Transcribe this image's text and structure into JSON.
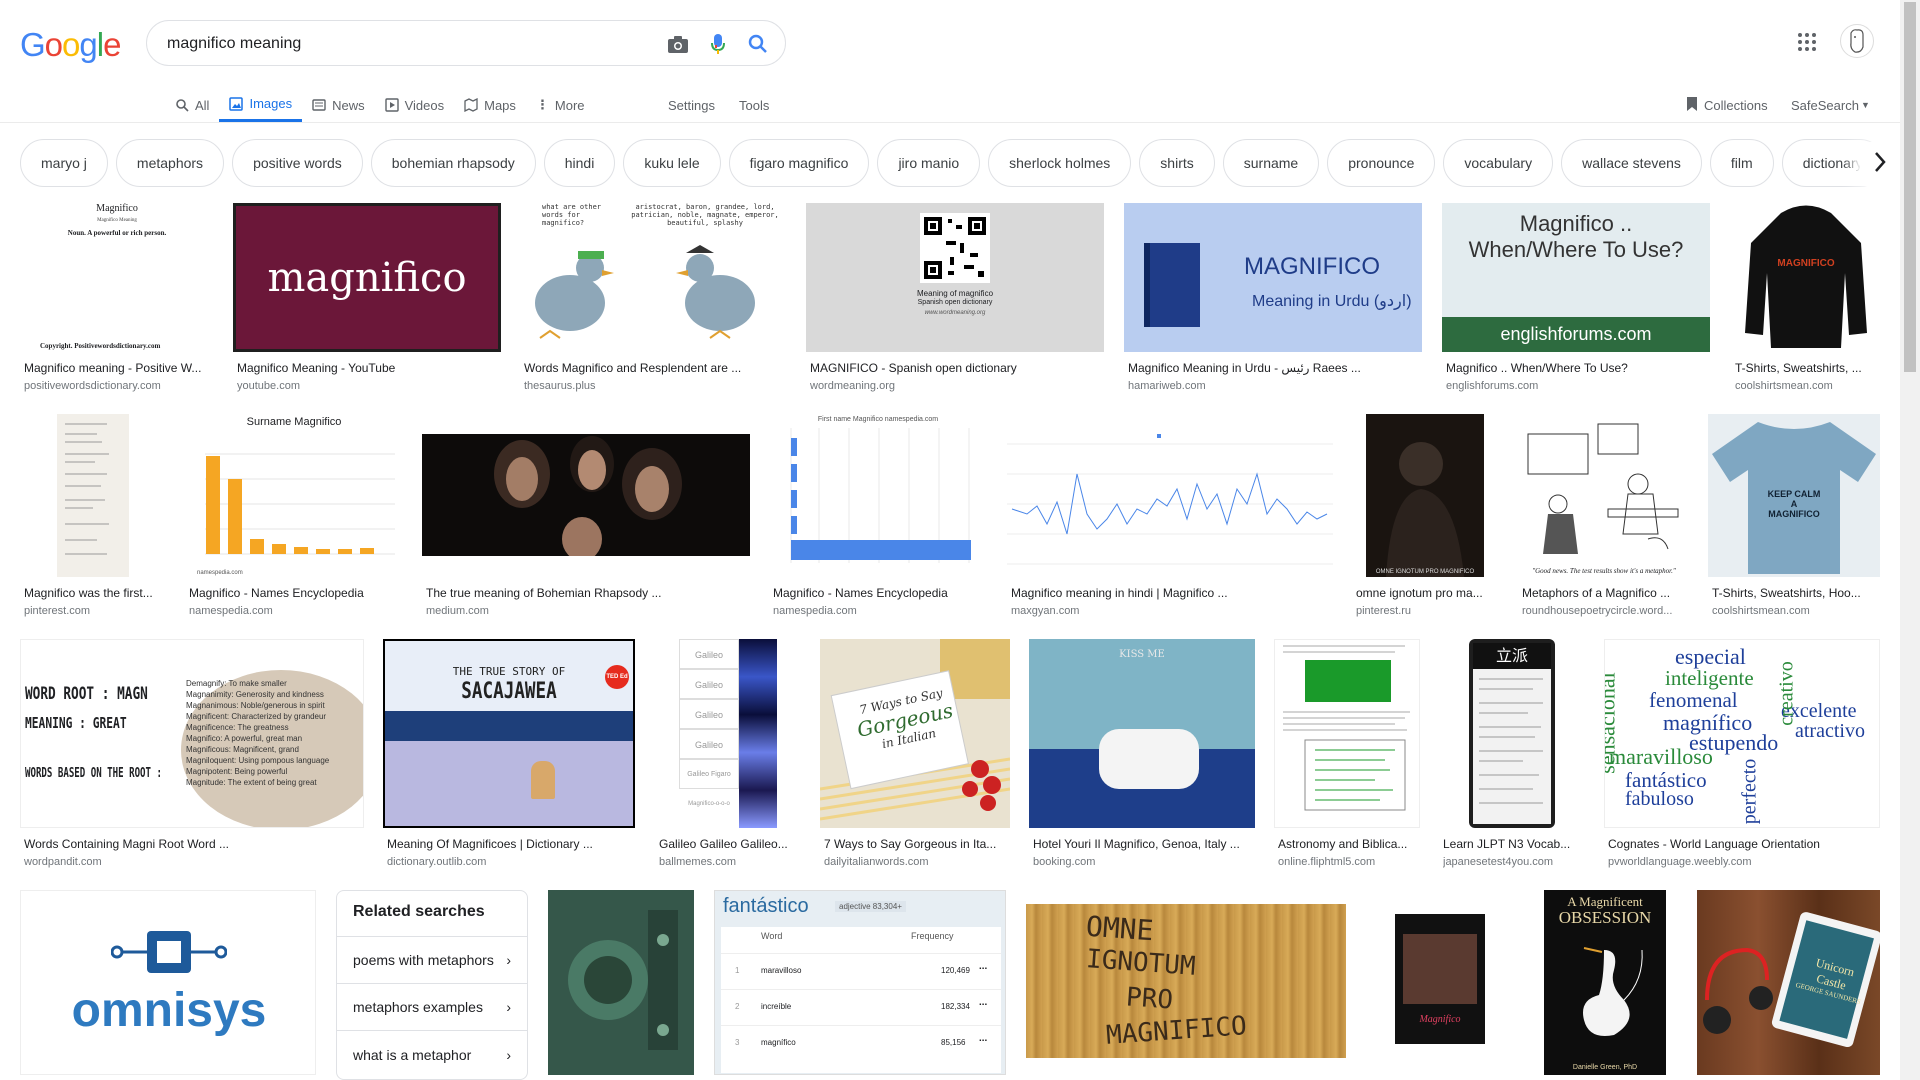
{
  "search": {
    "query": "magnifico meaning"
  },
  "logo": [
    "G",
    "o",
    "o",
    "g",
    "l",
    "e"
  ],
  "tabs": [
    {
      "label": "All",
      "active": false
    },
    {
      "label": "Images",
      "active": true
    },
    {
      "label": "News",
      "active": false
    },
    {
      "label": "Videos",
      "active": false
    },
    {
      "label": "Maps",
      "active": false
    },
    {
      "label": "More",
      "active": false
    }
  ],
  "tools": {
    "settings": "Settings",
    "tools": "Tools",
    "collections": "Collections",
    "safesearch": "SafeSearch"
  },
  "chips": [
    "maryo j",
    "metaphors",
    "positive words",
    "bohemian rhapsody",
    "hindi",
    "kuku lele",
    "figaro magnifico",
    "jiro manio",
    "sherlock holmes",
    "shirts",
    "surname",
    "pronounce",
    "vocabulary",
    "wallace stevens",
    "film",
    "dictionary"
  ],
  "row1": [
    {
      "caption": "Magnifico meaning - Positive W...",
      "domain": "positivewordsdictionary.com",
      "thumb_title": "Magnifico",
      "thumb_sub": "Magnifico   Meaning",
      "thumb_text": "Noun.  A powerful  or rich person.",
      "thumb_footer": "Copyright.  Positivewordsdictionary.com"
    },
    {
      "caption": "Magnifico Meaning - YouTube",
      "domain": "youtube.com",
      "thumb_text": "magnifico"
    },
    {
      "caption": "Words Magnifico and Resplendent are ...",
      "domain": "thesaurus.plus",
      "thumb_text": "what are other words for magnifico?",
      "thumb_text2": "aristocrat, baron, grandee, lord, patrician, noble, magnate, emperor, beautiful, splashy"
    },
    {
      "caption": "MAGNIFICO - Spanish open dictionary",
      "domain": "wordmeaning.org",
      "thumb_text": "Meaning of magnifico",
      "thumb_text2": "Spanish open dictionary",
      "thumb_text3": "www.wordmeaning.org"
    },
    {
      "caption": "Magnifico Meaning in Urdu - رئیس Raees ...",
      "domain": "hamariweb.com",
      "thumb_text": "MAGNIFICO",
      "thumb_text2": "Meaning in Urdu (اردو)"
    },
    {
      "caption": "Magnifico .. When/Where To Use?",
      "domain": "englishforums.com",
      "thumb_text": "Magnifico ..",
      "thumb_text2": "When/Where To Use?",
      "thumb_text3": "englishforums.com"
    },
    {
      "caption": "T-Shirts, Sweatshirts, ...",
      "domain": "coolshirtsmean.com",
      "thumb_text": "MAGNIFICO"
    }
  ],
  "row2": [
    {
      "caption": "Magnifico was the first...",
      "domain": "pinterest.com"
    },
    {
      "caption": "Magnifico - Names Encyclopedia",
      "domain": "namespedia.com",
      "thumb_text": "Surname Magnifico"
    },
    {
      "caption": "The true meaning of Bohemian Rhapsody ...",
      "domain": "medium.com"
    },
    {
      "caption": "Magnifico - Names Encyclopedia",
      "domain": "namespedia.com",
      "thumb_text": "First name Magnifico namespedia.com"
    },
    {
      "caption": "Magnifico meaning in hindi | Magnifico ...",
      "domain": "maxgyan.com"
    },
    {
      "caption": "omne ignotum pro ma...",
      "domain": "pinterest.ru",
      "thumb_text": "OMNE IGNOTUM PRO MAGNIFICO"
    },
    {
      "caption": "Metaphors of a Magnifico ...",
      "domain": "roundhousepoetrycircle.word...",
      "thumb_text": "\"Good news. The test results show it's a metaphor.\""
    },
    {
      "caption": "T-Shirts, Sweatshirts, Hoo...",
      "domain": "coolshirtsmean.com",
      "thumb_text": "KEEP CALM A MAGNIFICO"
    }
  ],
  "row3": [
    {
      "caption": "Words Containing Magni Root Word ...",
      "domain": "wordpandit.com",
      "thumb_lines": [
        "WORD ROOT : MAGN",
        "MEANING : GREAT",
        "WORDS BASED ON THE ROOT :"
      ],
      "thumb_list": [
        "Demagnify: To make smaller",
        "Magnanimity: Generosity and kindness",
        "Magnanimous: Noble/generous in spirit",
        "Magnificent: Characterized by grandeur",
        "Magnificence: The greatness",
        "Magnifico: A powerful, great man",
        "Magnificous: Magnificent, grand",
        "Magniloquent: Using pompous language",
        "Magnipotent: Being powerful",
        "Magnitude: The extent of being great"
      ]
    },
    {
      "caption": "Meaning Of Magnificoes | Dictionary ...",
      "domain": "dictionary.outlib.com",
      "thumb_text": "THE TRUE STORY OF",
      "thumb_text2": "SACAJAWEA",
      "thumb_badge": "TED Ed"
    },
    {
      "caption": "Galileo Galileo Galileo...",
      "domain": "ballmemes.com",
      "thumb_list": [
        "Galileo",
        "Galileo",
        "Galileo",
        "Galileo",
        "Galileo Figaro",
        "Magnifico-o-o-o"
      ]
    },
    {
      "caption": "7 Ways to Say Gorgeous in Ita...",
      "domain": "dailyitalianwords.com",
      "thumb_text": "7 Ways to Say",
      "thumb_text2": "Gorgeous",
      "thumb_text3": "in Italian"
    },
    {
      "caption": "Hotel Youri Il Magnifico, Genoa, Italy ...",
      "domain": "booking.com",
      "thumb_text": "KISS ME"
    },
    {
      "caption": "Astronomy and Biblica...",
      "domain": "online.fliphtml5.com"
    },
    {
      "caption": "Learn JLPT N3 Vocab...",
      "domain": "japanesetest4you.com",
      "thumb_text": "立派"
    },
    {
      "caption": "Cognates - World Language Orientation",
      "domain": "pvworldlanguage.weebly.com",
      "thumb_words": [
        "especial",
        "inteligente",
        "fenomenal",
        "magnífico",
        "estupendo",
        "excelente",
        "atractivo",
        "sensacional",
        "maravilloso",
        "fantástico",
        "fabuloso",
        "perfecto",
        "creativo"
      ]
    }
  ],
  "related": {
    "title": "Related searches",
    "items": [
      "poems with metaphors",
      "metaphors examples",
      "what is a metaphor"
    ]
  },
  "row4": {
    "omnisys": "omnisys",
    "freq_title": "fantástico",
    "freq_tag": "adjective 83,304+",
    "freq_head": [
      "Word",
      "Frequency"
    ],
    "freq_rows": [
      {
        "n": "1",
        "word": "maravilloso",
        "value": "120,469"
      },
      {
        "n": "2",
        "word": "increíble",
        "value": "182,334"
      },
      {
        "n": "3",
        "word": "magnífico",
        "value": "85,156"
      }
    ],
    "wood_text": [
      "OMNE",
      "IGNOTUM",
      "PRO",
      "MAGNIFICO"
    ],
    "book_title": "Magnifico",
    "book2_text": [
      "A Magnificent",
      "OBSESSION"
    ],
    "book2_author": "Danielle Green, PhD",
    "book3_text": [
      "Unicorn",
      "Castle",
      "GEORGE SAUNDERS"
    ]
  },
  "colors": {
    "accent": "#1a73e8",
    "g_blue": "#4285f4",
    "g_red": "#ea4335",
    "g_yellow": "#fbbc05",
    "g_green": "#34a853"
  }
}
